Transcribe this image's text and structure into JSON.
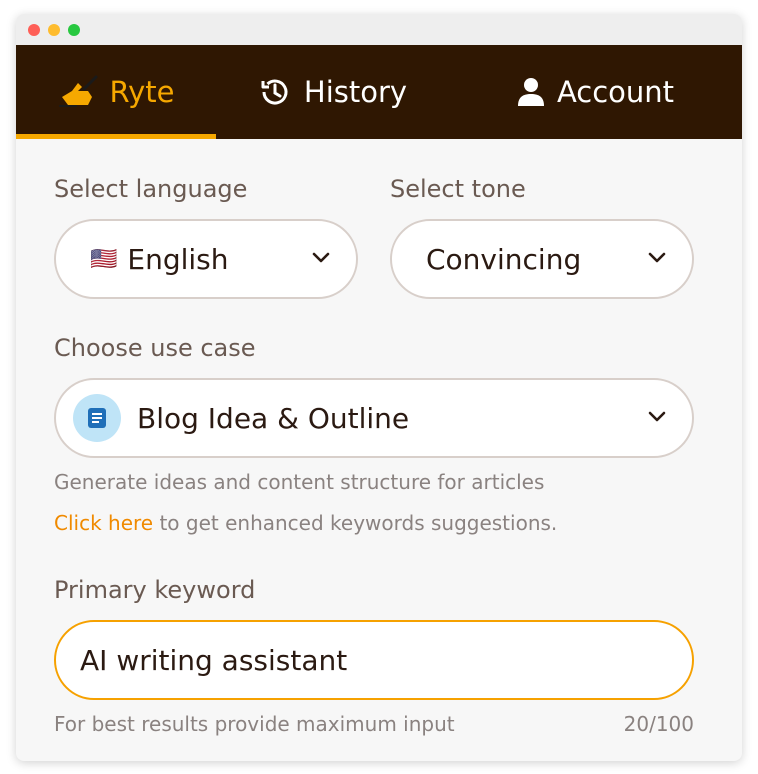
{
  "nav": {
    "tabs": [
      {
        "label": "Ryte",
        "icon": "writing-hand-icon",
        "active": true
      },
      {
        "label": "History",
        "icon": "history-icon",
        "active": false
      },
      {
        "label": "Account",
        "icon": "user-icon",
        "active": false
      }
    ]
  },
  "language": {
    "label": "Select language",
    "value": "English",
    "flag": "🇺🇸"
  },
  "tone": {
    "label": "Select tone",
    "value": "Convincing"
  },
  "use_case": {
    "label": "Choose use case",
    "value": "Blog Idea & Outline",
    "description": "Generate ideas and content structure for articles",
    "link_text": "Click here",
    "link_rest": " to get enhanced keywords suggestions."
  },
  "keyword": {
    "label": "Primary keyword",
    "value": "AI writing assistant",
    "hint": "For best results provide maximum input",
    "counter": "20/100"
  },
  "colors": {
    "nav_bg": "#2f1702",
    "accent": "#f6a800",
    "link": "#f08a00"
  }
}
